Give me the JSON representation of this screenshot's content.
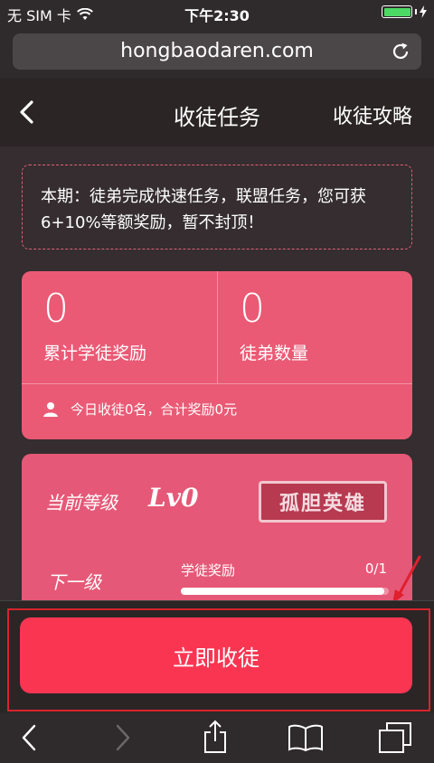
{
  "status": {
    "carrier": "无 SIM 卡",
    "time": "下午2:30"
  },
  "browser": {
    "url": "hongbaodaren.com"
  },
  "nav": {
    "title": "收徒任务",
    "guide_link": "收徒攻略"
  },
  "notice": {
    "text": "本期：徒弟完成快速任务，联盟任务，您可获6+10%等额奖励，暂不封顶！"
  },
  "stats": {
    "total_reward_value": "0",
    "total_reward_label": "累计学徒奖励",
    "apprentice_count_value": "0",
    "apprentice_count_label": "徒弟数量",
    "today_summary": "今日收徒0名，合计奖励0元"
  },
  "level": {
    "current_label": "当前等级",
    "current_value": "Lv0",
    "title_badge": "孤胆英雄",
    "next_label": "下一级",
    "progress_label": "学徒奖励",
    "progress_text": "0/1",
    "progress_fraction": 0.98
  },
  "cta": {
    "label": "立即收徒"
  },
  "colors": {
    "accent": "#fa3552",
    "card": "#ea5a75",
    "highlight_box": "#d9232e",
    "battery": "#4cd964"
  }
}
